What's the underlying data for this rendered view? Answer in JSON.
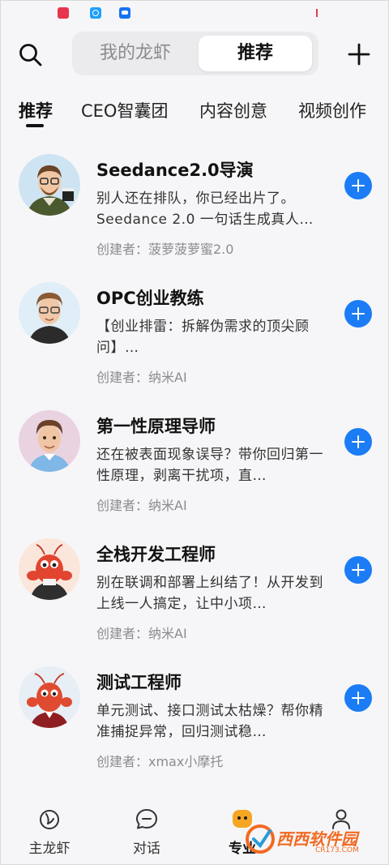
{
  "header": {
    "segments": [
      {
        "label": "我的龙虾",
        "active": false
      },
      {
        "label": "推荐",
        "active": true
      }
    ]
  },
  "tabs": [
    {
      "label": "推荐",
      "active": true
    },
    {
      "label": "CEO智囊团",
      "active": false
    },
    {
      "label": "内容创意",
      "active": false
    },
    {
      "label": "视频创作",
      "active": false
    }
  ],
  "agents": [
    {
      "name": "Seedance2.0导演",
      "description": "别人还在排队，你已经出片了。Seedance 2.0 一句话生成真人…",
      "creator": "创建者：菠萝菠萝蜜2.0",
      "avatar": "director-avatar"
    },
    {
      "name": "OPC创业教练",
      "description": "【创业排雷：拆解伪需求的顶尖顾问】…",
      "creator": "创建者：纳米AI",
      "avatar": "coach-avatar"
    },
    {
      "name": "第一性原理导师",
      "description": "还在被表面现象误导？带你回归第一性原理，剥离干扰项，直…",
      "creator": "创建者：纳米AI",
      "avatar": "mentor-avatar"
    },
    {
      "name": "全栈开发工程师",
      "description": "别在联调和部署上纠结了！从开发到上线一人搞定，让中小项…",
      "creator": "创建者：纳米AI",
      "avatar": "lobster-dev-avatar"
    },
    {
      "name": "测试工程师",
      "description": "单元测试、接口测试太枯燥？帮你精准捕捉异常，回归测试稳…",
      "creator": "创建者：xmax小摩托",
      "avatar": "lobster-qa-avatar"
    }
  ],
  "bottom_nav": [
    {
      "label": "主龙虾",
      "icon": "lobster-icon",
      "active": false
    },
    {
      "label": "对话",
      "icon": "chat-bubble-icon",
      "active": false
    },
    {
      "label": "专业",
      "icon": "pro-face-icon",
      "active": true
    },
    {
      "label": "",
      "icon": "profile-icon",
      "active": false
    }
  ],
  "watermark": {
    "text": "西西软件园",
    "sub": "CR173.COM"
  },
  "colors": {
    "accent": "#1b7cf5",
    "pro_icon": "#f5a623",
    "watermark": "#f26a22"
  }
}
